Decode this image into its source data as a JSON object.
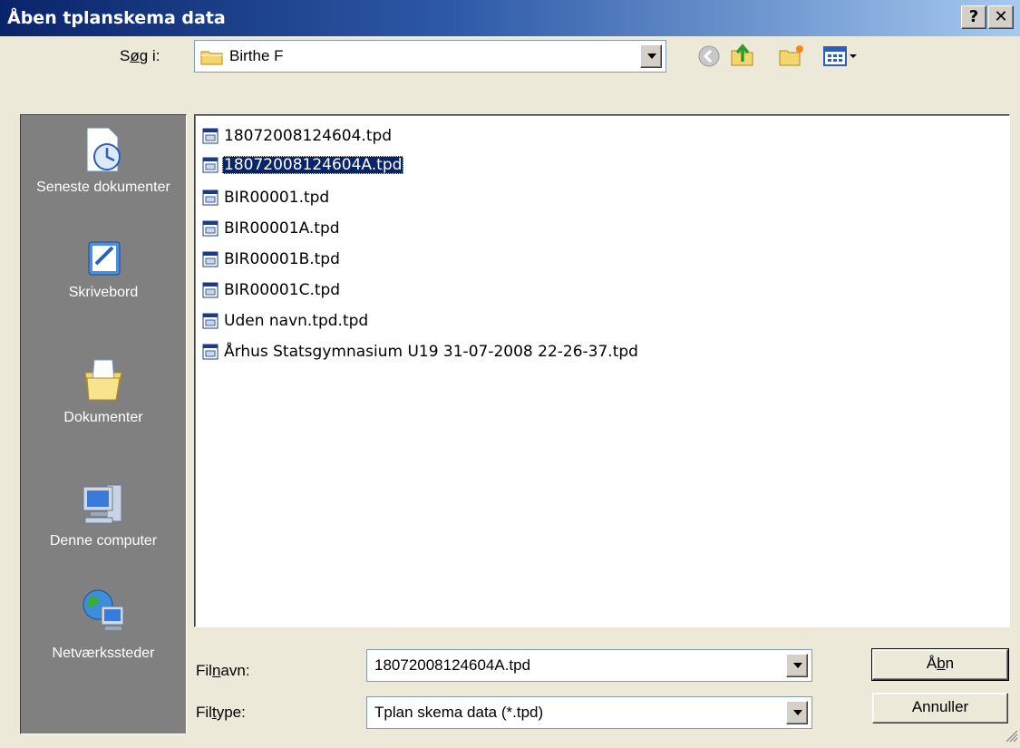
{
  "window": {
    "title": "Åben tplanskema data",
    "help_label": "?",
    "close_label": "✕"
  },
  "look_in": {
    "label_pre": "S",
    "label_ul": "ø",
    "label_post": "g i:",
    "value": "Birthe F"
  },
  "toolbar": {
    "icons": [
      "back-icon",
      "up-folder-icon",
      "new-folder-icon",
      "view-menu-icon"
    ]
  },
  "places": [
    {
      "label": "Seneste dokumenter",
      "icon": "recent-documents-icon"
    },
    {
      "label": "Skrivebord",
      "icon": "desktop-icon"
    },
    {
      "label": "Dokumenter",
      "icon": "my-documents-icon"
    },
    {
      "label": "Denne computer",
      "icon": "my-computer-icon"
    },
    {
      "label": "Netværkssteder",
      "icon": "network-places-icon"
    }
  ],
  "files": [
    {
      "name": "18072008124604.tpd",
      "selected": false
    },
    {
      "name": "18072008124604A.tpd",
      "selected": true
    },
    {
      "name": "BIR00001.tpd",
      "selected": false
    },
    {
      "name": "BIR00001A.tpd",
      "selected": false
    },
    {
      "name": "BIR00001B.tpd",
      "selected": false
    },
    {
      "name": "BIR00001C.tpd",
      "selected": false
    },
    {
      "name": "Uden navn.tpd.tpd",
      "selected": false
    },
    {
      "name": "Århus Statsgymnasium U19 31-07-2008 22-26-37.tpd",
      "selected": false
    }
  ],
  "filename": {
    "label_pre": "Fil",
    "label_ul": "n",
    "label_post": "avn:",
    "value": "18072008124604A.tpd"
  },
  "filetype": {
    "label_pre": "Fil",
    "label_ul": "t",
    "label_post": "ype:",
    "value": "Tplan skema data (*.tpd)"
  },
  "buttons": {
    "open": {
      "pre": "Å",
      "ul": "b",
      "post": "n"
    },
    "cancel": "Annuller"
  },
  "colors": {
    "titlebar_start": "#0A246A",
    "titlebar_end": "#A6CAF0",
    "selection": "#0A246A",
    "places_bg": "#808080",
    "dialog_bg": "#ECE9D8"
  }
}
